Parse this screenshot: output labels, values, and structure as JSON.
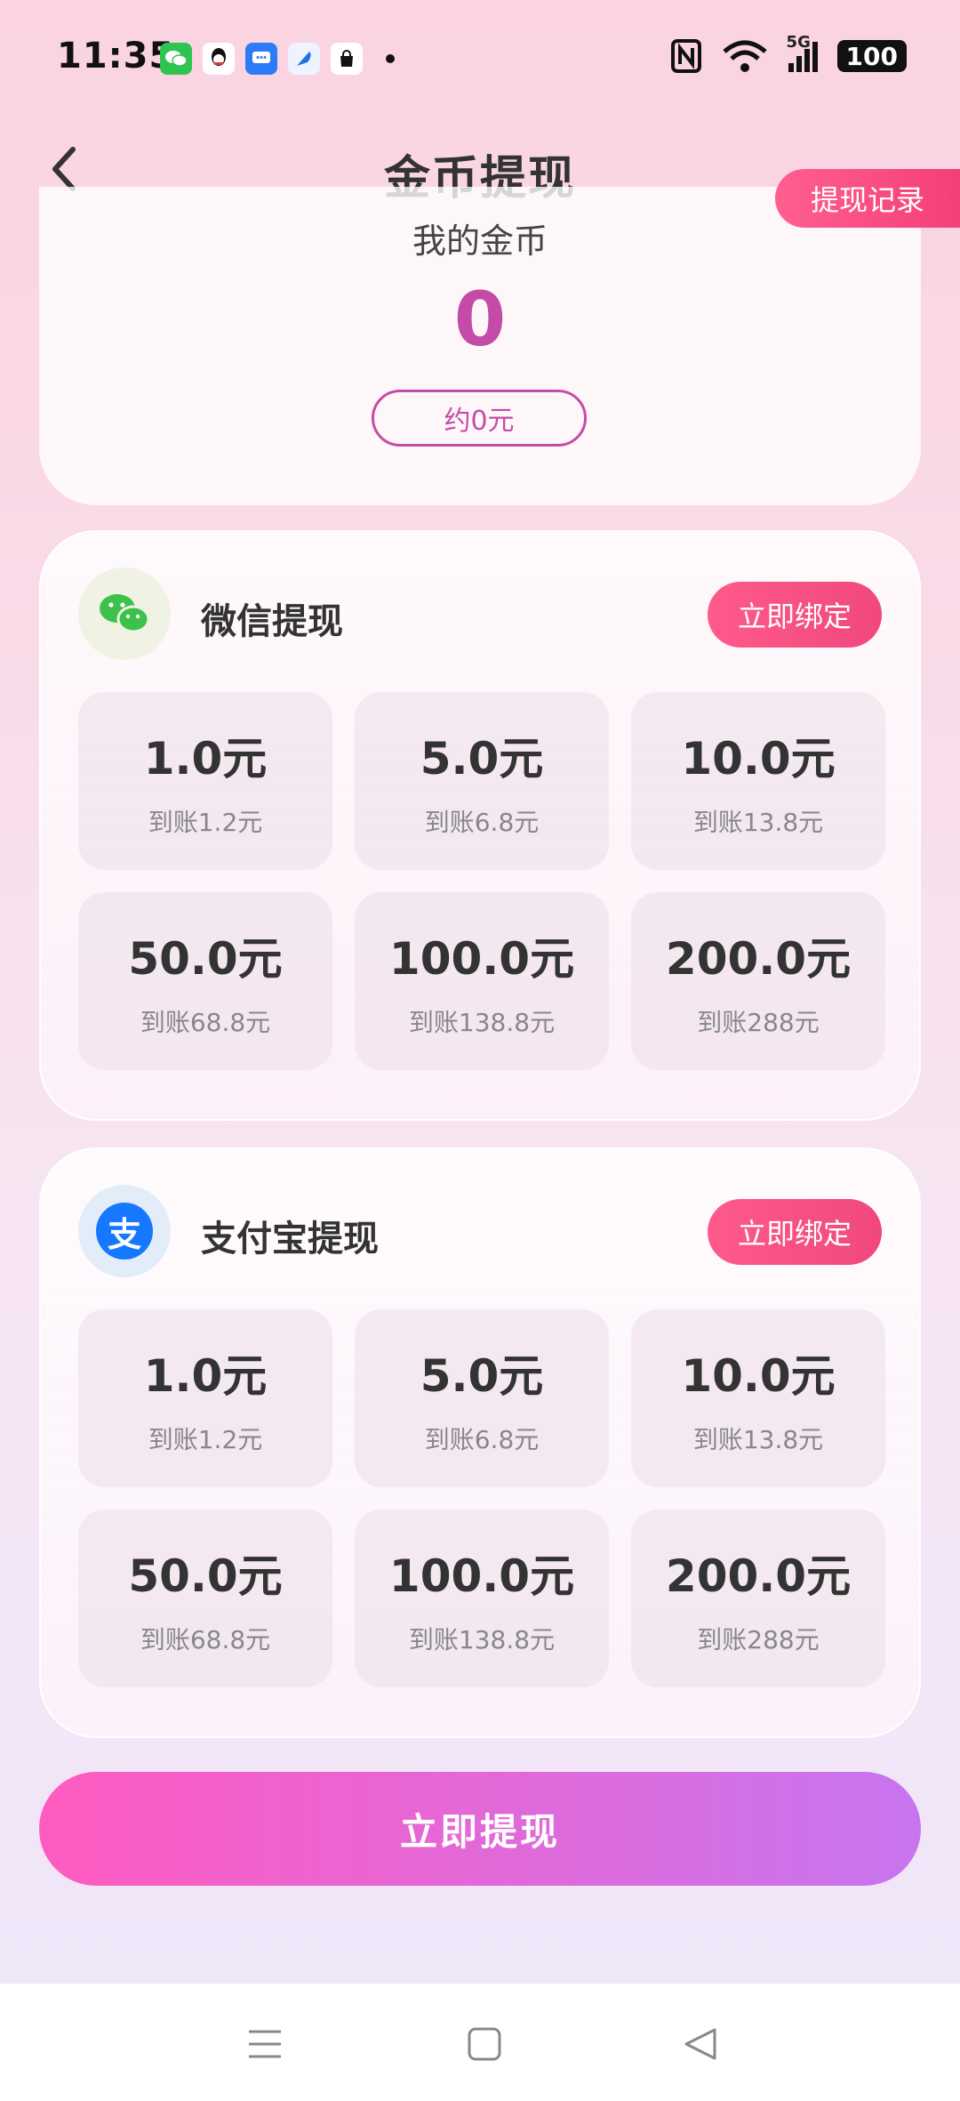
{
  "status_bar": {
    "time": "11:35",
    "network": "5G",
    "battery": "100",
    "app_icons": [
      "wechat-icon",
      "qq-icon",
      "message-icon",
      "browser-icon",
      "bag-icon"
    ]
  },
  "header": {
    "title": "金币提现",
    "records_label": "提现记录",
    "back_icon": "chevron-left-icon"
  },
  "coin_card": {
    "label": "我的金币",
    "value": "0",
    "approx": "约0元",
    "accent": "#c54ba8"
  },
  "wechat": {
    "title": "微信提现",
    "bind_label": "立即绑定",
    "icon": "wechat-icon",
    "options": [
      {
        "amount": "1.0元",
        "receive": "到账1.2元"
      },
      {
        "amount": "5.0元",
        "receive": "到账6.8元"
      },
      {
        "amount": "10.0元",
        "receive": "到账13.8元"
      },
      {
        "amount": "50.0元",
        "receive": "到账68.8元"
      },
      {
        "amount": "100.0元",
        "receive": "到账138.8元"
      },
      {
        "amount": "200.0元",
        "receive": "到账288元"
      }
    ]
  },
  "alipay": {
    "title": "支付宝提现",
    "bind_label": "立即绑定",
    "icon": "alipay-icon",
    "icon_text": "支",
    "options": [
      {
        "amount": "1.0元",
        "receive": "到账1.2元"
      },
      {
        "amount": "5.0元",
        "receive": "到账6.8元"
      },
      {
        "amount": "10.0元",
        "receive": "到账13.8元"
      },
      {
        "amount": "50.0元",
        "receive": "到账68.8元"
      },
      {
        "amount": "100.0元",
        "receive": "到账138.8元"
      },
      {
        "amount": "200.0元",
        "receive": "到账288元"
      }
    ]
  },
  "cta_label": "立即提现",
  "colors": {
    "bind_button": "#f4497f",
    "cta_start": "#ff5bc0",
    "cta_end": "#c775ef",
    "wechat_green": "#3cc24a",
    "alipay_blue": "#1677ff"
  },
  "nav_bar": [
    "menu-icon",
    "home-square-icon",
    "back-triangle-icon"
  ]
}
